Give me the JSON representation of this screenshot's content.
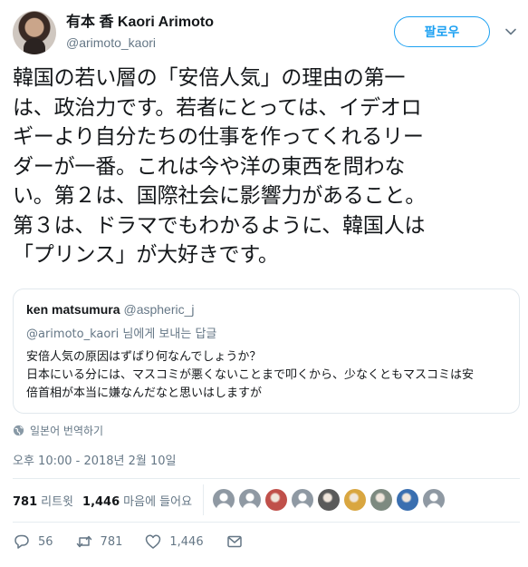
{
  "author": {
    "display_name": "有本 香 Kaori Arimoto",
    "handle": "@arimoto_kaori"
  },
  "follow_button": "팔로우",
  "tweet": {
    "text": "韓国の若い層の「安倍人気」の理由の第一\nは、政治力です。若者にとっては、イデオロ\nギーより自分たちの仕事を作ってくれるリー\nダーが一番。これは今や洋の東西を問わな\nい。第２は、国際社会に影響力があること。\n第３は、ドラマでもわかるように、韓国人は\n「プリンス」が大好きです。"
  },
  "quoted_tweet": {
    "name": "ken matsumura",
    "handle": "@aspheric_j",
    "reply_mention": "@arimoto_kaori",
    "reply_suffix": " 님에게 보내는 답글",
    "text": "安倍人気の原因はずばり何なんでしょうか？\n日本にいる分には、マスコミが悪くないことまで叩くから、少なくともマスコミは安\n倍首相が本当に嫌なんだなと思いはしますが"
  },
  "translate_label": "일본어 번역하기",
  "timestamp": "오후 10:00 - 2018년 2월 10일",
  "stats": {
    "retweets_count": "781",
    "retweets_label": "리트윗",
    "likes_count": "1,446",
    "likes_label": "마음에 들어요"
  },
  "liker_avatars": [
    {
      "color": "#8f99a3",
      "icon": "default-avatar"
    },
    {
      "color": "#8f99a3",
      "icon": "default-avatar"
    },
    {
      "color": "#c0504a",
      "icon": "user-avatar"
    },
    {
      "color": "#8f99a3",
      "icon": "default-avatar"
    },
    {
      "color": "#5a5a5a",
      "icon": "user-avatar"
    },
    {
      "color": "#d9a640",
      "icon": "user-avatar"
    },
    {
      "color": "#7d8a80",
      "icon": "user-avatar"
    },
    {
      "color": "#3a6fb0",
      "icon": "user-avatar"
    },
    {
      "color": "#8f99a3",
      "icon": "default-avatar"
    }
  ],
  "actions": {
    "reply_count": "56",
    "retweet_count": "781",
    "like_count": "1,446"
  },
  "colors": {
    "accent": "#1da1f2",
    "muted": "#657786",
    "text": "#14171a"
  }
}
